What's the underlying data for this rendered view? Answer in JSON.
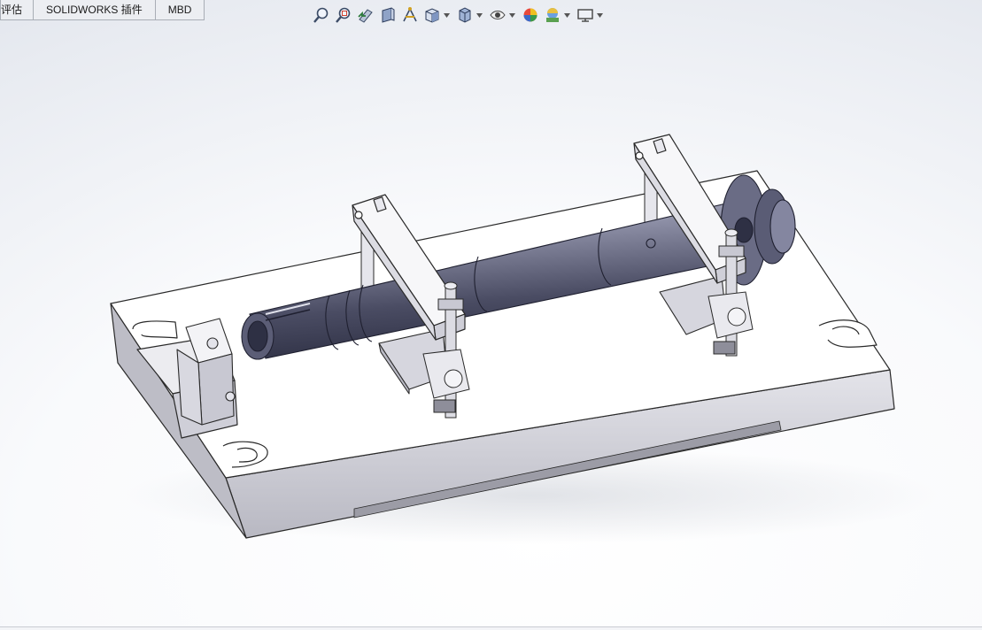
{
  "tabs": [
    {
      "label": "评估",
      "cut": true
    },
    {
      "label": "SOLIDWORKS 插件"
    },
    {
      "label": "MBD"
    }
  ],
  "heads_up_toolbar": [
    {
      "icon": "zoom-to-fit-icon"
    },
    {
      "icon": "zoom-to-area-icon"
    },
    {
      "icon": "previous-view-icon"
    },
    {
      "icon": "section-view-icon"
    },
    {
      "icon": "dynamic-annotation-icon"
    },
    {
      "icon": "view-orientation-icon",
      "dropdown": true
    },
    {
      "icon": "display-style-icon",
      "dropdown": true
    },
    {
      "icon": "hide-show-items-icon",
      "dropdown": true
    },
    {
      "icon": "edit-appearance-icon"
    },
    {
      "icon": "apply-scene-icon",
      "dropdown": true
    },
    {
      "icon": "view-settings-icon",
      "dropdown": true
    }
  ],
  "colors": {
    "plate_top": "#ffffff",
    "plate_side": "#cfcfd6",
    "shaft_dark": "#45475e",
    "shaft_light": "#c9cad8",
    "viewport_edge": "#dde1e9"
  }
}
